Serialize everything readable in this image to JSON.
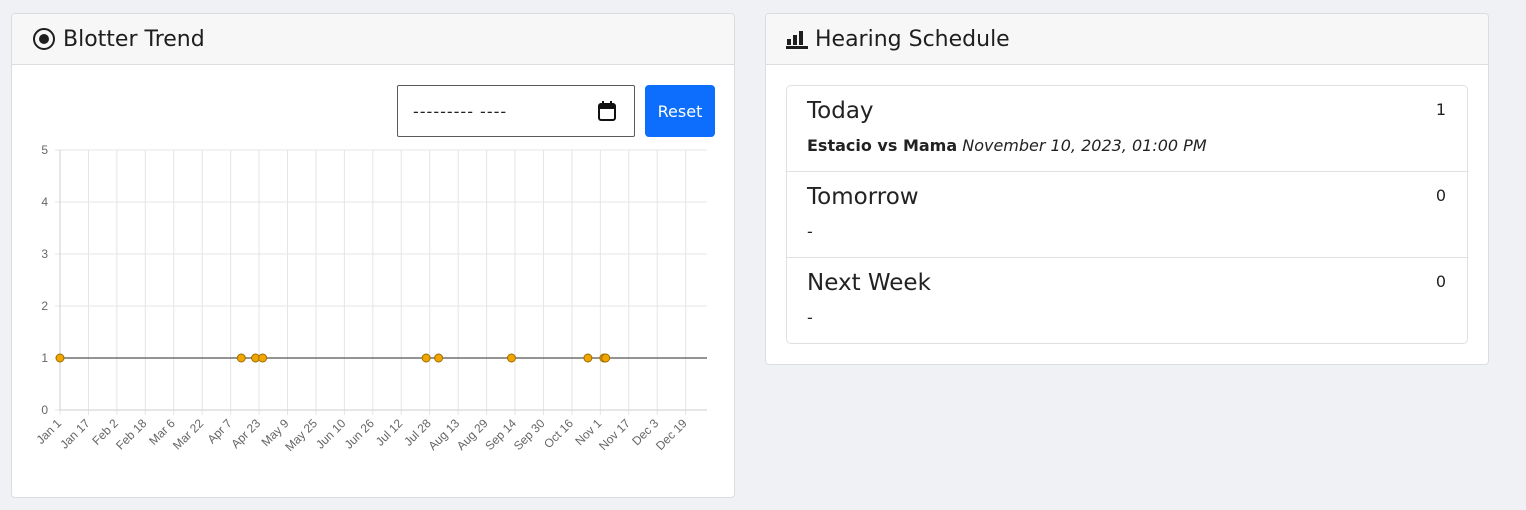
{
  "blotter": {
    "title": "Blotter Trend",
    "icon": "dot-circle-icon",
    "date_filter_value": "--------- ----",
    "reset_label": "Reset"
  },
  "chart_data": {
    "type": "line",
    "y_ticks": [
      "0",
      "1",
      "2",
      "3",
      "4",
      "5"
    ],
    "ylim": [
      0,
      5
    ],
    "x_tick_labels": [
      "Jan 1",
      "Jan 17",
      "Feb 2",
      "Feb 18",
      "Mar 6",
      "Mar 22",
      "Apr 7",
      "Apr 23",
      "May 9",
      "May 25",
      "Jun 10",
      "Jun 26",
      "Jul 12",
      "Jul 28",
      "Aug 13",
      "Aug 29",
      "Sep 14",
      "Sep 30",
      "Oct 16",
      "Nov 1",
      "Nov 17",
      "Dec 3",
      "Dec 19"
    ],
    "x_range": [
      "Jan 1",
      "Dec 31"
    ],
    "series": [
      {
        "color": "#f0a500",
        "line_color": "#555555",
        "points": [
          {
            "x": "Jan 1",
            "y": 1
          },
          {
            "x": "Apr 13",
            "y": 1
          },
          {
            "x": "Apr 21",
            "y": 1
          },
          {
            "x": "Apr 25",
            "y": 1
          },
          {
            "x": "Jul 26",
            "y": 1
          },
          {
            "x": "Aug 2",
            "y": 1
          },
          {
            "x": "Sep 12",
            "y": 1
          },
          {
            "x": "Oct 25",
            "y": 1
          },
          {
            "x": "Nov 3",
            "y": 1
          },
          {
            "x": "Nov 4",
            "y": 1
          }
        ]
      }
    ],
    "grid": true
  },
  "hearing": {
    "title": "Hearing Schedule",
    "icon": "bar-chart-icon",
    "items": [
      {
        "label": "Today",
        "count": "1",
        "case": "Estacio vs Mama",
        "when": "November 10, 2023, 01:00 PM",
        "empty": ""
      },
      {
        "label": "Tomorrow",
        "count": "0",
        "case": "",
        "when": "",
        "empty": "-"
      },
      {
        "label": "Next Week",
        "count": "0",
        "case": "",
        "when": "",
        "empty": "-"
      }
    ]
  },
  "colors": {
    "accent": "#0d6efd",
    "point_fill": "#f0a500",
    "page_bg": "#f0f1f5"
  }
}
